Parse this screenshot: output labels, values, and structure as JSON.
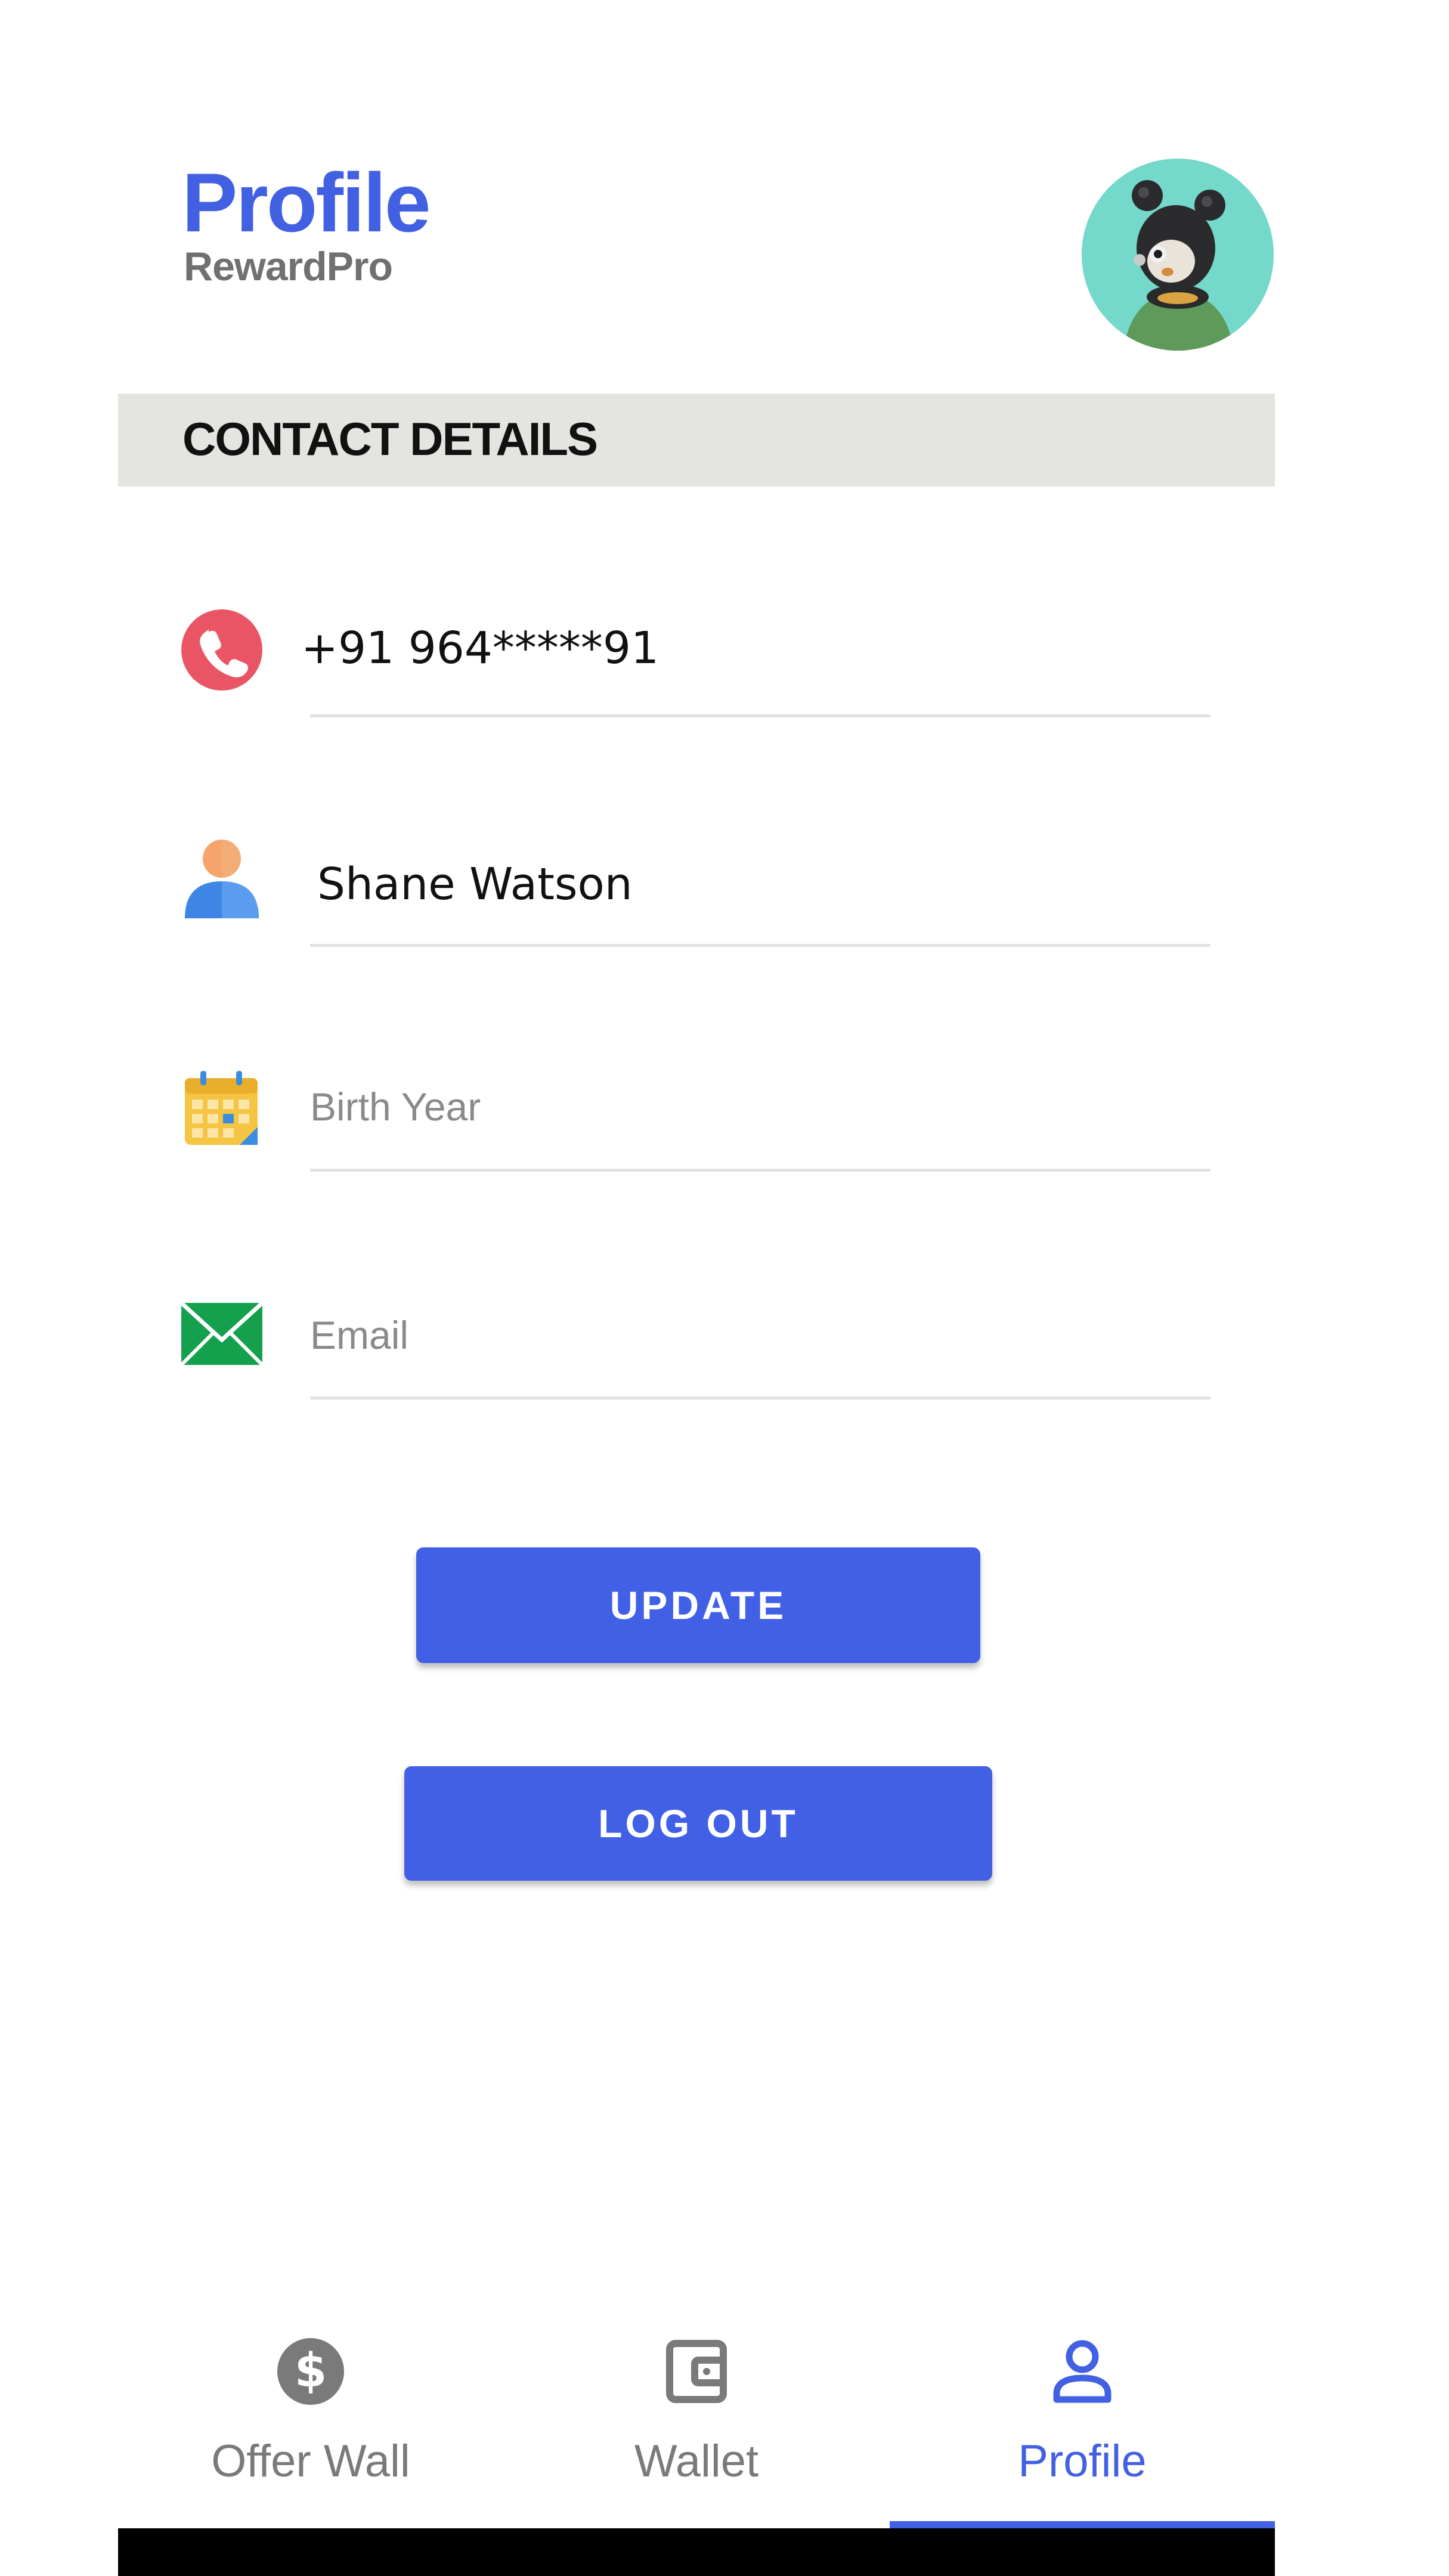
{
  "header": {
    "title": "Profile",
    "subtitle": "RewardPro"
  },
  "section": {
    "title": "CONTACT DETAILS"
  },
  "fields": {
    "phone": {
      "value": "+91 964*****91",
      "icon": "phone-icon"
    },
    "name": {
      "value": "Shane Watson",
      "icon": "user-icon"
    },
    "birth_year": {
      "placeholder": "Birth Year",
      "icon": "calendar-icon"
    },
    "email": {
      "placeholder": "Email",
      "icon": "envelope-icon"
    }
  },
  "buttons": {
    "update": "UPDATE",
    "logout": "LOG OUT"
  },
  "nav": {
    "items": [
      {
        "label": "Offer Wall",
        "icon": "dollar-coin-icon"
      },
      {
        "label": "Wallet",
        "icon": "wallet-icon"
      },
      {
        "label": "Profile",
        "icon": "user-outline-icon"
      }
    ],
    "active_index": 2
  },
  "colors": {
    "accent": "#4260E2",
    "button": "#4160E6",
    "section_bg": "#E4E4E1",
    "avatar_bg": "#74D8CB"
  }
}
